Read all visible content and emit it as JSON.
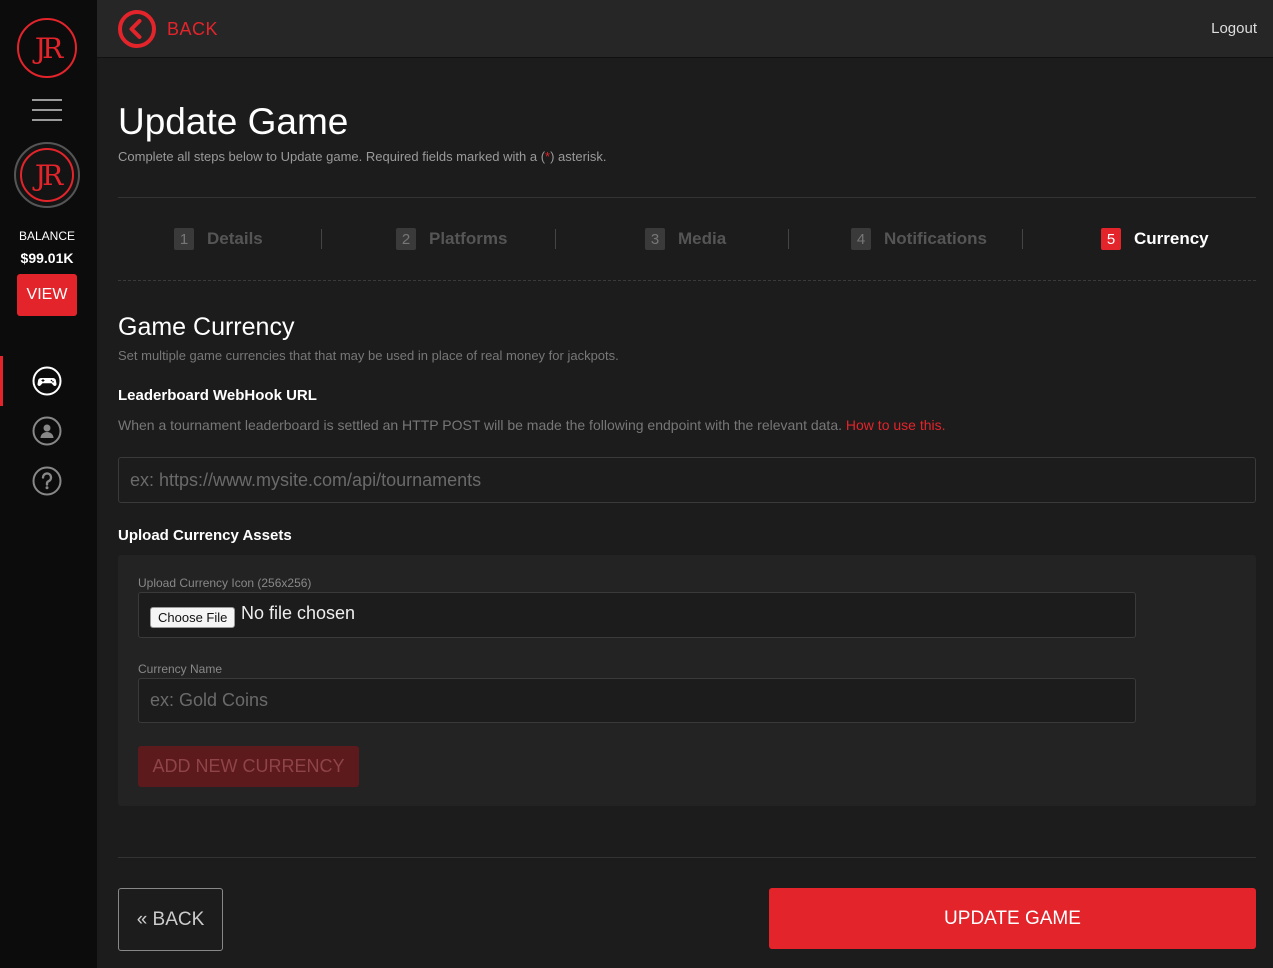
{
  "brand": {
    "logo_text": "JR",
    "accent": "#e3242b"
  },
  "sidebar": {
    "balance_label": "BALANCE",
    "balance_value": "$99.01K",
    "view_label": "VIEW",
    "nav": [
      {
        "icon": "gamepad-icon",
        "active": true
      },
      {
        "icon": "user-icon",
        "active": false
      },
      {
        "icon": "help-icon",
        "active": false
      }
    ]
  },
  "topbar": {
    "back_label": "BACK",
    "logout_label": "Logout"
  },
  "page": {
    "title": "Update Game",
    "subtitle_before": "Complete all steps below to Update game. Required fields marked with a (",
    "subtitle_asterisk": "*",
    "subtitle_after": ") asterisk."
  },
  "steps": [
    {
      "num": "1",
      "label": "Details",
      "active": false
    },
    {
      "num": "2",
      "label": "Platforms",
      "active": false
    },
    {
      "num": "3",
      "label": "Media",
      "active": false
    },
    {
      "num": "4",
      "label": "Notifications",
      "active": false
    },
    {
      "num": "5",
      "label": "Currency",
      "active": true
    }
  ],
  "currency": {
    "title": "Game Currency",
    "subtitle": "Set multiple game currencies that that may be used in place of real money for jackpots.",
    "webhook_label": "Leaderboard WebHook URL",
    "webhook_help": "When a tournament leaderboard is settled an HTTP POST will be made the following endpoint with the relevant data.",
    "webhook_link": "How to use this.",
    "webhook_placeholder": "ex: https://www.mysite.com/api/tournaments",
    "assets_label": "Upload Currency Assets",
    "icon_label": "Upload Currency Icon (256x256)",
    "choose_file": "Choose File",
    "no_file": "No file chosen",
    "name_label": "Currency Name",
    "name_placeholder": "ex: Gold Coins",
    "add_button": "ADD NEW CURRENCY"
  },
  "footer": {
    "back_label": "« BACK",
    "update_label": "UPDATE GAME"
  }
}
